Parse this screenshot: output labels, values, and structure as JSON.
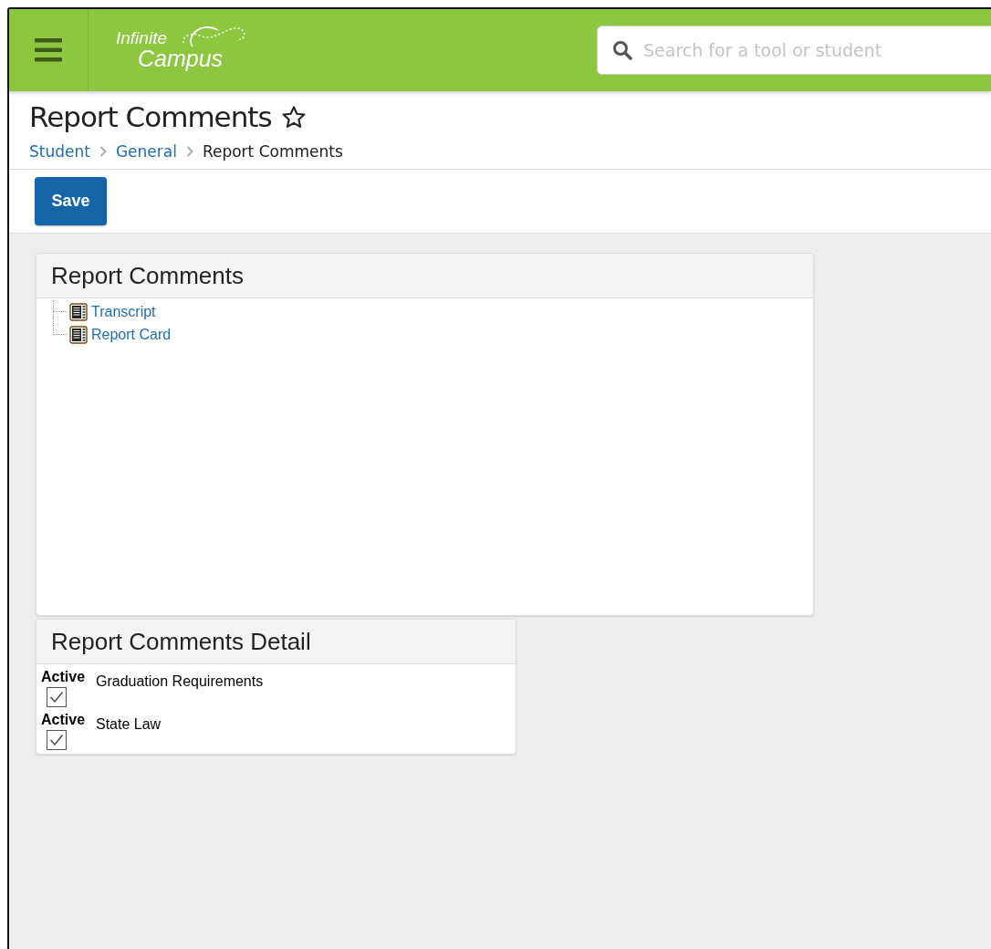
{
  "header": {
    "logo": {
      "line_1": "Infinite",
      "line_2": "Campus"
    },
    "search": {
      "placeholder": "Search for a tool or student"
    }
  },
  "page": {
    "title": "Report Comments",
    "favorite": false,
    "breadcrumb": [
      {
        "label": "Student",
        "link": true
      },
      {
        "label": "General",
        "link": true
      },
      {
        "label": "Report Comments",
        "link": false
      }
    ]
  },
  "toolbar": {
    "buttons": [
      "Save"
    ]
  },
  "comments_panel": {
    "title": "Report Comments",
    "items": [
      {
        "label": "Transcript"
      },
      {
        "label": "Report Card"
      }
    ]
  },
  "detail_panel": {
    "title": "Report Comments Detail",
    "rows": [
      {
        "label": "Active",
        "checked": true,
        "name": "Graduation Requirements"
      },
      {
        "label": "Active",
        "checked": true,
        "name": "State Law"
      }
    ]
  }
}
